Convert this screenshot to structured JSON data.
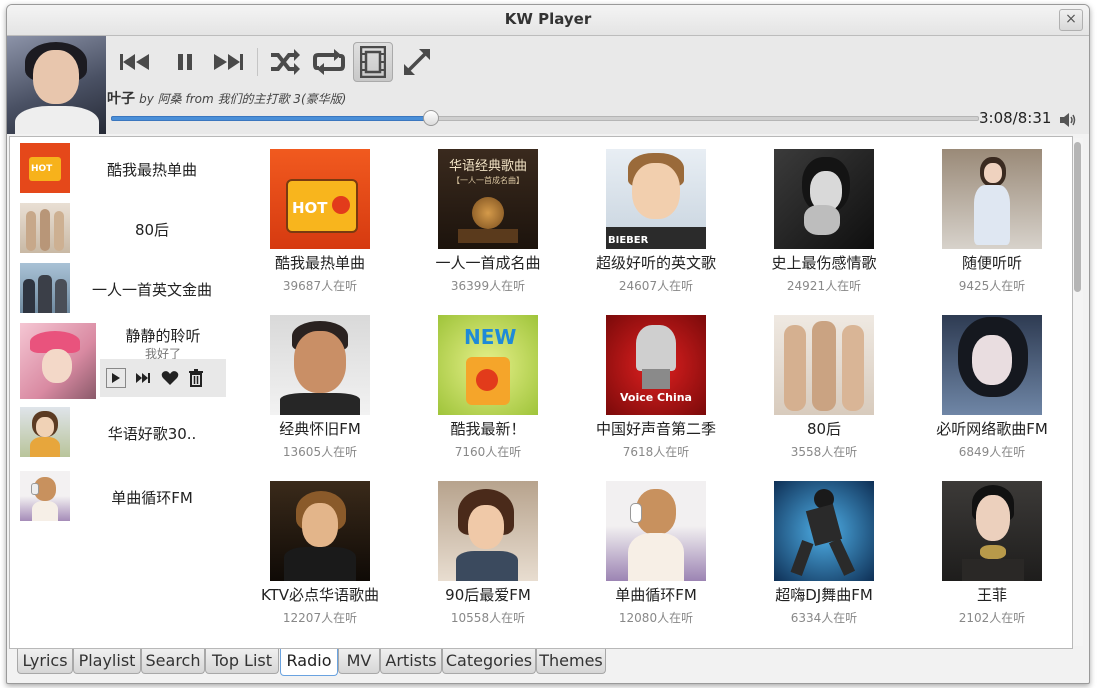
{
  "window": {
    "title": "KW Player",
    "close_label": "×"
  },
  "player": {
    "track_title": "叶子",
    "track_meta": "by 阿桑 from 我们的主打歌 3(豪华版)",
    "time": "3:08/8:31",
    "progress": 0.37,
    "controls": [
      "previous-icon",
      "pause-icon",
      "next-icon",
      "shuffle-icon",
      "repeat-icon",
      "video-icon",
      "fullscreen-icon"
    ]
  },
  "sidebar": {
    "items": [
      {
        "label": "酷我最热单曲",
        "thumb": "hot-radio"
      },
      {
        "label": "80后",
        "thumb": "group-photo"
      },
      {
        "label": "一人一首英文金曲",
        "thumb": "band-photo"
      },
      {
        "label": "静静的聆听",
        "sub": "我好了",
        "thumb": "girl-pink"
      },
      {
        "label": "华语好歌30..",
        "thumb": "girl-field"
      },
      {
        "label": "单曲循环FM",
        "thumb": "girl-headphones"
      }
    ]
  },
  "stations": [
    {
      "name": "酷我最热单曲",
      "count": "39687人在听"
    },
    {
      "name": "一人一首成名曲",
      "count": "36399人在听",
      "cover_text": "华语经典歌曲",
      "cover_sub": "【一人一首成名曲】"
    },
    {
      "name": "超级好听的英文歌",
      "count": "24607人在听",
      "cover_text": "BIEBER"
    },
    {
      "name": "史上最伤感情歌",
      "count": "24921人在听"
    },
    {
      "name": "随便听听",
      "count": "9425人在听"
    },
    {
      "name": "经典怀旧FM",
      "count": "13605人在听"
    },
    {
      "name": "酷我最新！",
      "count": "7160人在听",
      "cover_text": "NEW"
    },
    {
      "name": "中国好声音第二季",
      "count": "7618人在听",
      "cover_text": "Voice China"
    },
    {
      "name": "80后",
      "count": "3558人在听"
    },
    {
      "name": "必听网络歌曲FM",
      "count": "6849人在听"
    },
    {
      "name": "KTV必点华语歌曲",
      "count": "12207人在听"
    },
    {
      "name": "90后最爱FM",
      "count": "10558人在听"
    },
    {
      "name": "单曲循环FM",
      "count": "12080人在听"
    },
    {
      "name": "超嗨DJ舞曲FM",
      "count": "6334人在听"
    },
    {
      "name": "王菲",
      "count": "2102人在听"
    }
  ],
  "tabs": [
    "Lyrics",
    "Playlist",
    "Search",
    "Top List",
    "Radio",
    "MV",
    "Artists",
    "Categories",
    "Themes"
  ],
  "active_tab": "Radio",
  "colors": {
    "accent": "#4a8fd8",
    "tab_active_border": "#6aa3e0"
  }
}
